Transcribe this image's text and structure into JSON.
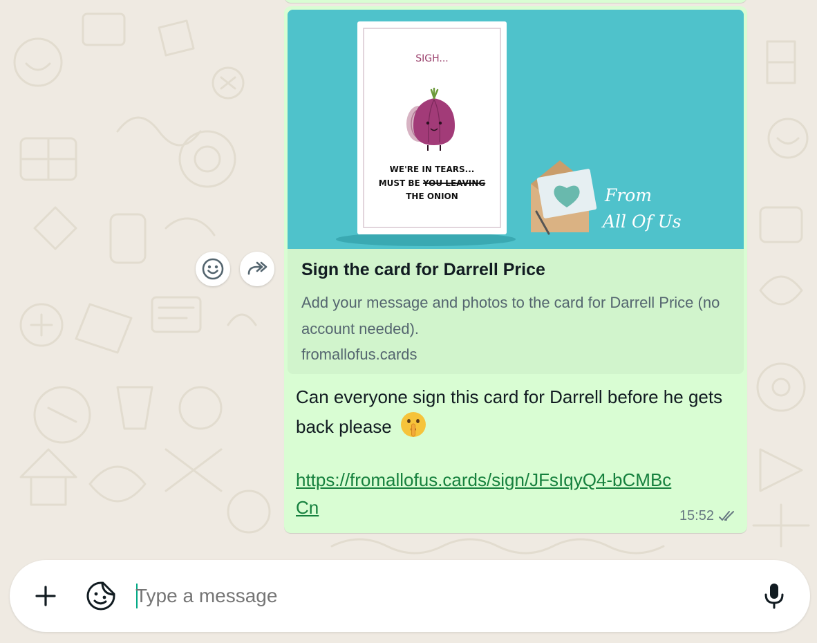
{
  "chat": {
    "link_preview": {
      "title": "Sign the card for Darrell Price",
      "description": "Add your message and photos to the card for Darrell Price (no account needed).",
      "domain": "fromallofus.cards",
      "image": {
        "card_top_text": "SIGH...",
        "card_line1": "WE'RE IN TEARS...",
        "card_line2_prefix": "MUST BE ",
        "card_line2_struck": "YOU LEAVING",
        "card_line3": "THE ONION",
        "brand_line1": "From",
        "brand_line2": "All Of Us"
      }
    },
    "message": {
      "text": "Can everyone sign this card for Darrell before he gets back please",
      "emoji": "shushing-face-emoji",
      "link": "https://fromallofus.cards/sign/JFsIqyQ4-bCMBcCn",
      "time": "15:52",
      "status_icon": "double-check-icon"
    },
    "hover_actions": [
      "smiley-icon",
      "forward-icon"
    ]
  },
  "composer": {
    "placeholder": "Type a message",
    "attach_icon": "plus-icon",
    "sticker_icon": "sticker-icon",
    "mic_icon": "microphone-icon"
  },
  "colors": {
    "wallpaper": "#efeae2",
    "outgoing_bubble": "#d9fdd3",
    "preview_bg": "#d1f4cc",
    "preview_image_bg": "#4fc2cb",
    "link": "#15803d",
    "caret": "#00a884"
  }
}
